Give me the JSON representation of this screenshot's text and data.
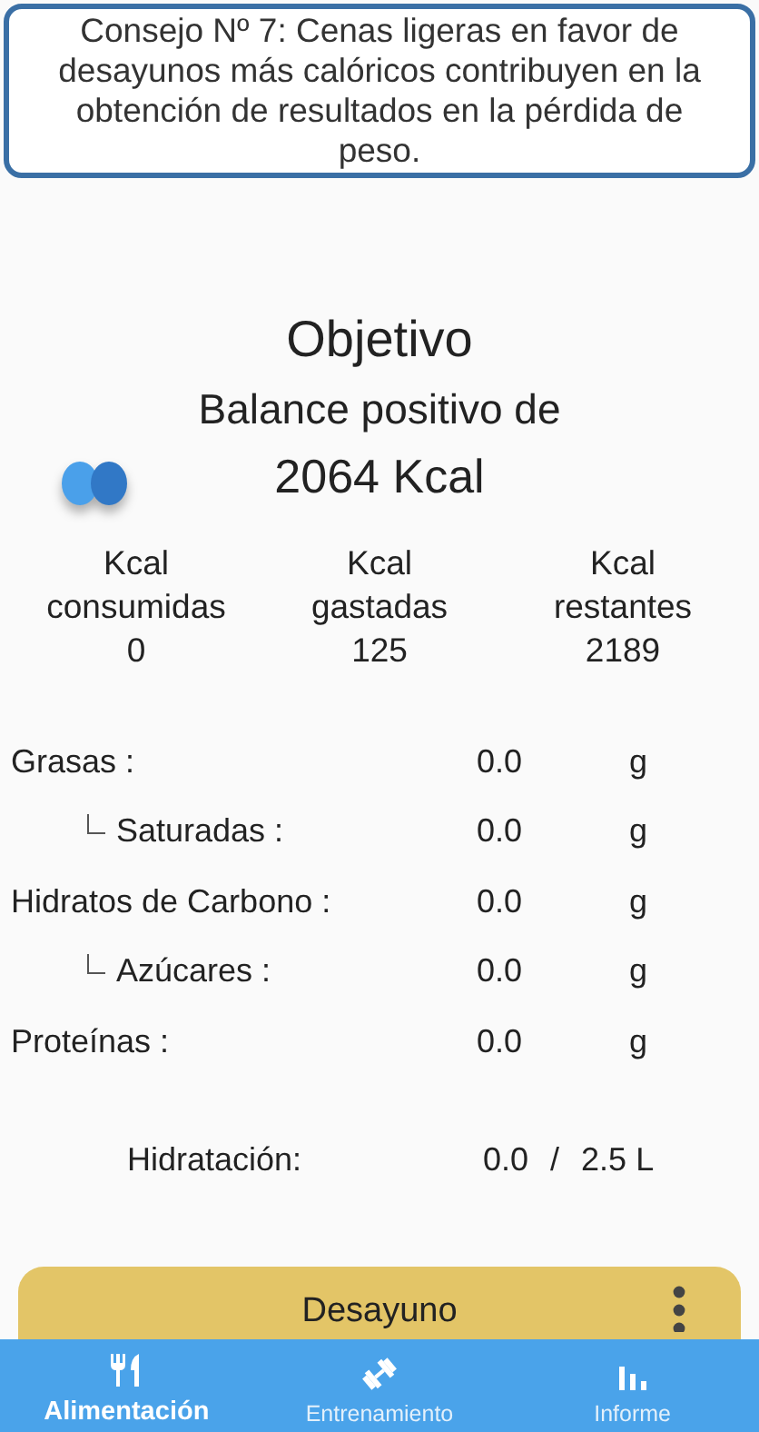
{
  "tip": "Consejo Nº 7: Cenas ligeras en favor de desayunos más calóricos contribuyen en la obtención de resultados en la pérdida de peso.",
  "goal": {
    "title": "Objetivo",
    "subtitle": "Balance positivo de",
    "value": "2064 Kcal"
  },
  "summary": [
    {
      "label": "Kcal\nconsumidas",
      "value": "0"
    },
    {
      "label": "Kcal\ngastadas",
      "value": "125"
    },
    {
      "label": "Kcal\nrestantes",
      "value": "2189"
    }
  ],
  "nutrients": [
    {
      "name": "Grasas :",
      "value": "0.0",
      "unit": "g",
      "children": [
        {
          "name": "Saturadas :",
          "value": "0.0",
          "unit": "g"
        }
      ]
    },
    {
      "name": "Hidratos de Carbono :",
      "value": "0.0",
      "unit": "g",
      "children": [
        {
          "name": "Azúcares :",
          "value": "0.0",
          "unit": "g"
        }
      ]
    },
    {
      "name": "Proteínas :",
      "value": "0.0",
      "unit": "g"
    }
  ],
  "hydration": {
    "label": "Hidratación:",
    "value": "0.0",
    "separator": "/",
    "target": "2.5 L"
  },
  "meal": {
    "title": "Desayuno"
  },
  "nav": [
    {
      "kind": "food",
      "label": "Alimentación",
      "selected": true
    },
    {
      "kind": "training",
      "label": "Entrenamiento",
      "selected": false
    },
    {
      "kind": "report",
      "label": "Informe",
      "selected": false
    }
  ]
}
